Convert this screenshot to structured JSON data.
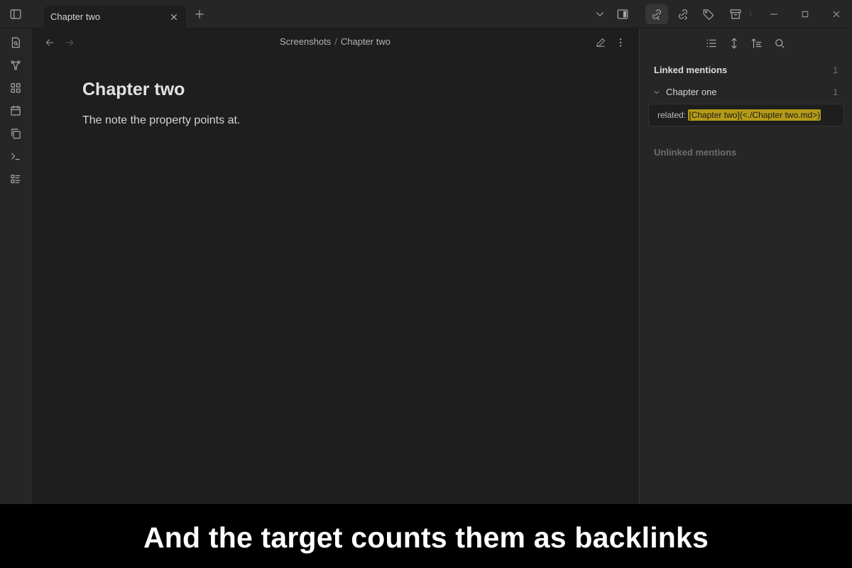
{
  "tab": {
    "title": "Chapter two"
  },
  "breadcrumb": {
    "folder": "Screenshots",
    "separator": "/",
    "file": "Chapter two"
  },
  "note": {
    "title": "Chapter two",
    "body": "The note the property points at."
  },
  "backlinks": {
    "linked_label": "Linked mentions",
    "linked_count": "1",
    "file_name": "Chapter one",
    "file_count": "1",
    "mention_prefix": "related:",
    "mention_highlight": "[Chapter two](<./Chapter two.md>)",
    "unlinked_label": "Unlinked mentions"
  },
  "caption": {
    "text": "And the target counts them as backlinks"
  },
  "icons": {
    "titlebar": [
      "sidebar-toggle-icon",
      "close-icon",
      "plus-icon",
      "chevron-down-icon",
      "layout-right-icon",
      "backlinks-icon",
      "outgoing-links-icon",
      "tag-icon",
      "archive-icon",
      "minimize-icon",
      "maximize-icon",
      "window-close-icon"
    ],
    "ribbon": [
      "file-search-icon",
      "graph-icon",
      "grid-icon",
      "calendar-icon",
      "copy-icon",
      "terminal-icon",
      "list-icon"
    ],
    "editor": [
      "arrow-left-icon",
      "arrow-right-icon",
      "pencil-icon",
      "more-vertical-icon"
    ],
    "panel": [
      "list-collapse-icon",
      "expand-vertical-icon",
      "sort-icon",
      "search-icon"
    ]
  },
  "colors": {
    "background": "#1e1e1e",
    "chrome": "#262626",
    "highlight": "#b59b17",
    "caption_bg": "#000000",
    "caption_text": "#ffffff"
  }
}
